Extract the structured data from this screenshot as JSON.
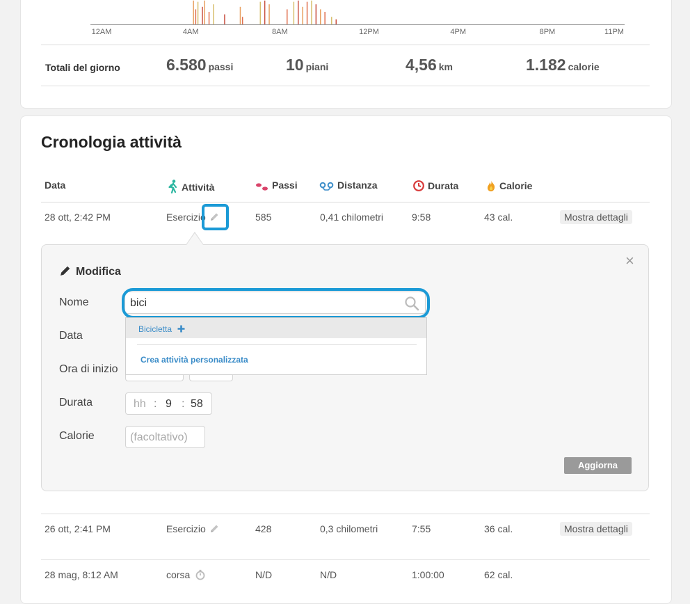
{
  "chart_data": {
    "type": "bar",
    "xlabel": "",
    "ylabel": "",
    "x_ticks": [
      "12AM",
      "4AM",
      "8AM",
      "12PM",
      "4PM",
      "8PM",
      "11PM"
    ],
    "x_tick_hours": [
      0,
      4,
      8,
      12,
      16,
      20,
      23
    ],
    "x_range_hours": [
      0,
      23.5
    ],
    "bar_intervals": [
      {
        "hour": 4.1,
        "level": 0.95
      },
      {
        "hour": 4.2,
        "level": 0.6
      },
      {
        "hour": 4.3,
        "level": 0.9
      },
      {
        "hour": 4.5,
        "level": 0.7
      },
      {
        "hour": 4.6,
        "level": 0.95
      },
      {
        "hour": 4.8,
        "level": 0.5
      },
      {
        "hour": 5.0,
        "level": 0.8
      },
      {
        "hour": 5.5,
        "level": 0.4
      },
      {
        "hour": 6.2,
        "level": 0.7
      },
      {
        "hour": 6.3,
        "level": 0.3
      },
      {
        "hour": 7.1,
        "level": 0.9
      },
      {
        "hour": 7.3,
        "level": 0.95
      },
      {
        "hour": 7.5,
        "level": 0.8
      },
      {
        "hour": 8.3,
        "level": 0.6
      },
      {
        "hour": 8.6,
        "level": 0.9
      },
      {
        "hour": 8.8,
        "level": 0.95
      },
      {
        "hour": 9.0,
        "level": 0.7
      },
      {
        "hour": 9.2,
        "level": 0.9
      },
      {
        "hour": 9.4,
        "level": 0.95
      },
      {
        "hour": 9.6,
        "level": 0.8
      },
      {
        "hour": 9.8,
        "level": 0.6
      },
      {
        "hour": 10.0,
        "level": 0.5
      },
      {
        "hour": 10.3,
        "level": 0.3
      },
      {
        "hour": 10.5,
        "level": 0.2
      }
    ],
    "colors": [
      "#e8a060",
      "#e07050",
      "#d8c070",
      "#c85040"
    ]
  },
  "totals": {
    "label": "Totali del giorno",
    "steps": {
      "value": "6.580",
      "unit": "passi"
    },
    "floors": {
      "value": "10",
      "unit": "piani"
    },
    "distance": {
      "value": "4,56",
      "unit": "km"
    },
    "calories": {
      "value": "1.182",
      "unit": "calorie"
    }
  },
  "history": {
    "title": "Cronologia attività",
    "columns": {
      "date": "Data",
      "activity": "Attività",
      "steps": "Passi",
      "distance": "Distanza",
      "duration": "Durata",
      "calories": "Calorie"
    },
    "rows": [
      {
        "date": "28 ott, 2:42 PM",
        "activity": "Esercizio",
        "steps": "585",
        "distance": "0,41 chilometri",
        "duration": "9:58",
        "calories": "43 cal.",
        "details": "Mostra dettagli"
      },
      {
        "date": "26 ott, 2:41 PM",
        "activity": "Esercizio",
        "steps": "428",
        "distance": "0,3 chilometri",
        "duration": "7:55",
        "calories": "36 cal.",
        "details": "Mostra dettagli"
      },
      {
        "date": "28 mag, 8:12 AM",
        "activity": "corsa",
        "steps": "N/D",
        "distance": "N/D",
        "duration": "1:00:00",
        "calories": "62 cal."
      }
    ]
  },
  "edit": {
    "title": "Modifica",
    "labels": {
      "name": "Nome",
      "date": "Data",
      "start_time": "Ora di inizio",
      "duration": "Durata",
      "calories": "Calorie"
    },
    "name_value": "bici",
    "suggestions": [
      "Bicicletta"
    ],
    "create_custom": "Crea attività personalizzata",
    "duration": {
      "hh_placeholder": "hh",
      "sep": ":",
      "mm": "9",
      "ss": "58"
    },
    "calories_placeholder": "(facoltativo)",
    "update_button": "Aggiorna",
    "close_glyph": "×"
  },
  "colors": {
    "highlight": "#1b9ad6",
    "link": "#3a8cc8",
    "steps_icon": "#d9446a",
    "duration_icon": "#d83a3a",
    "calories_icon": "#f0a020",
    "activity_icon": "#2bb6a0"
  }
}
